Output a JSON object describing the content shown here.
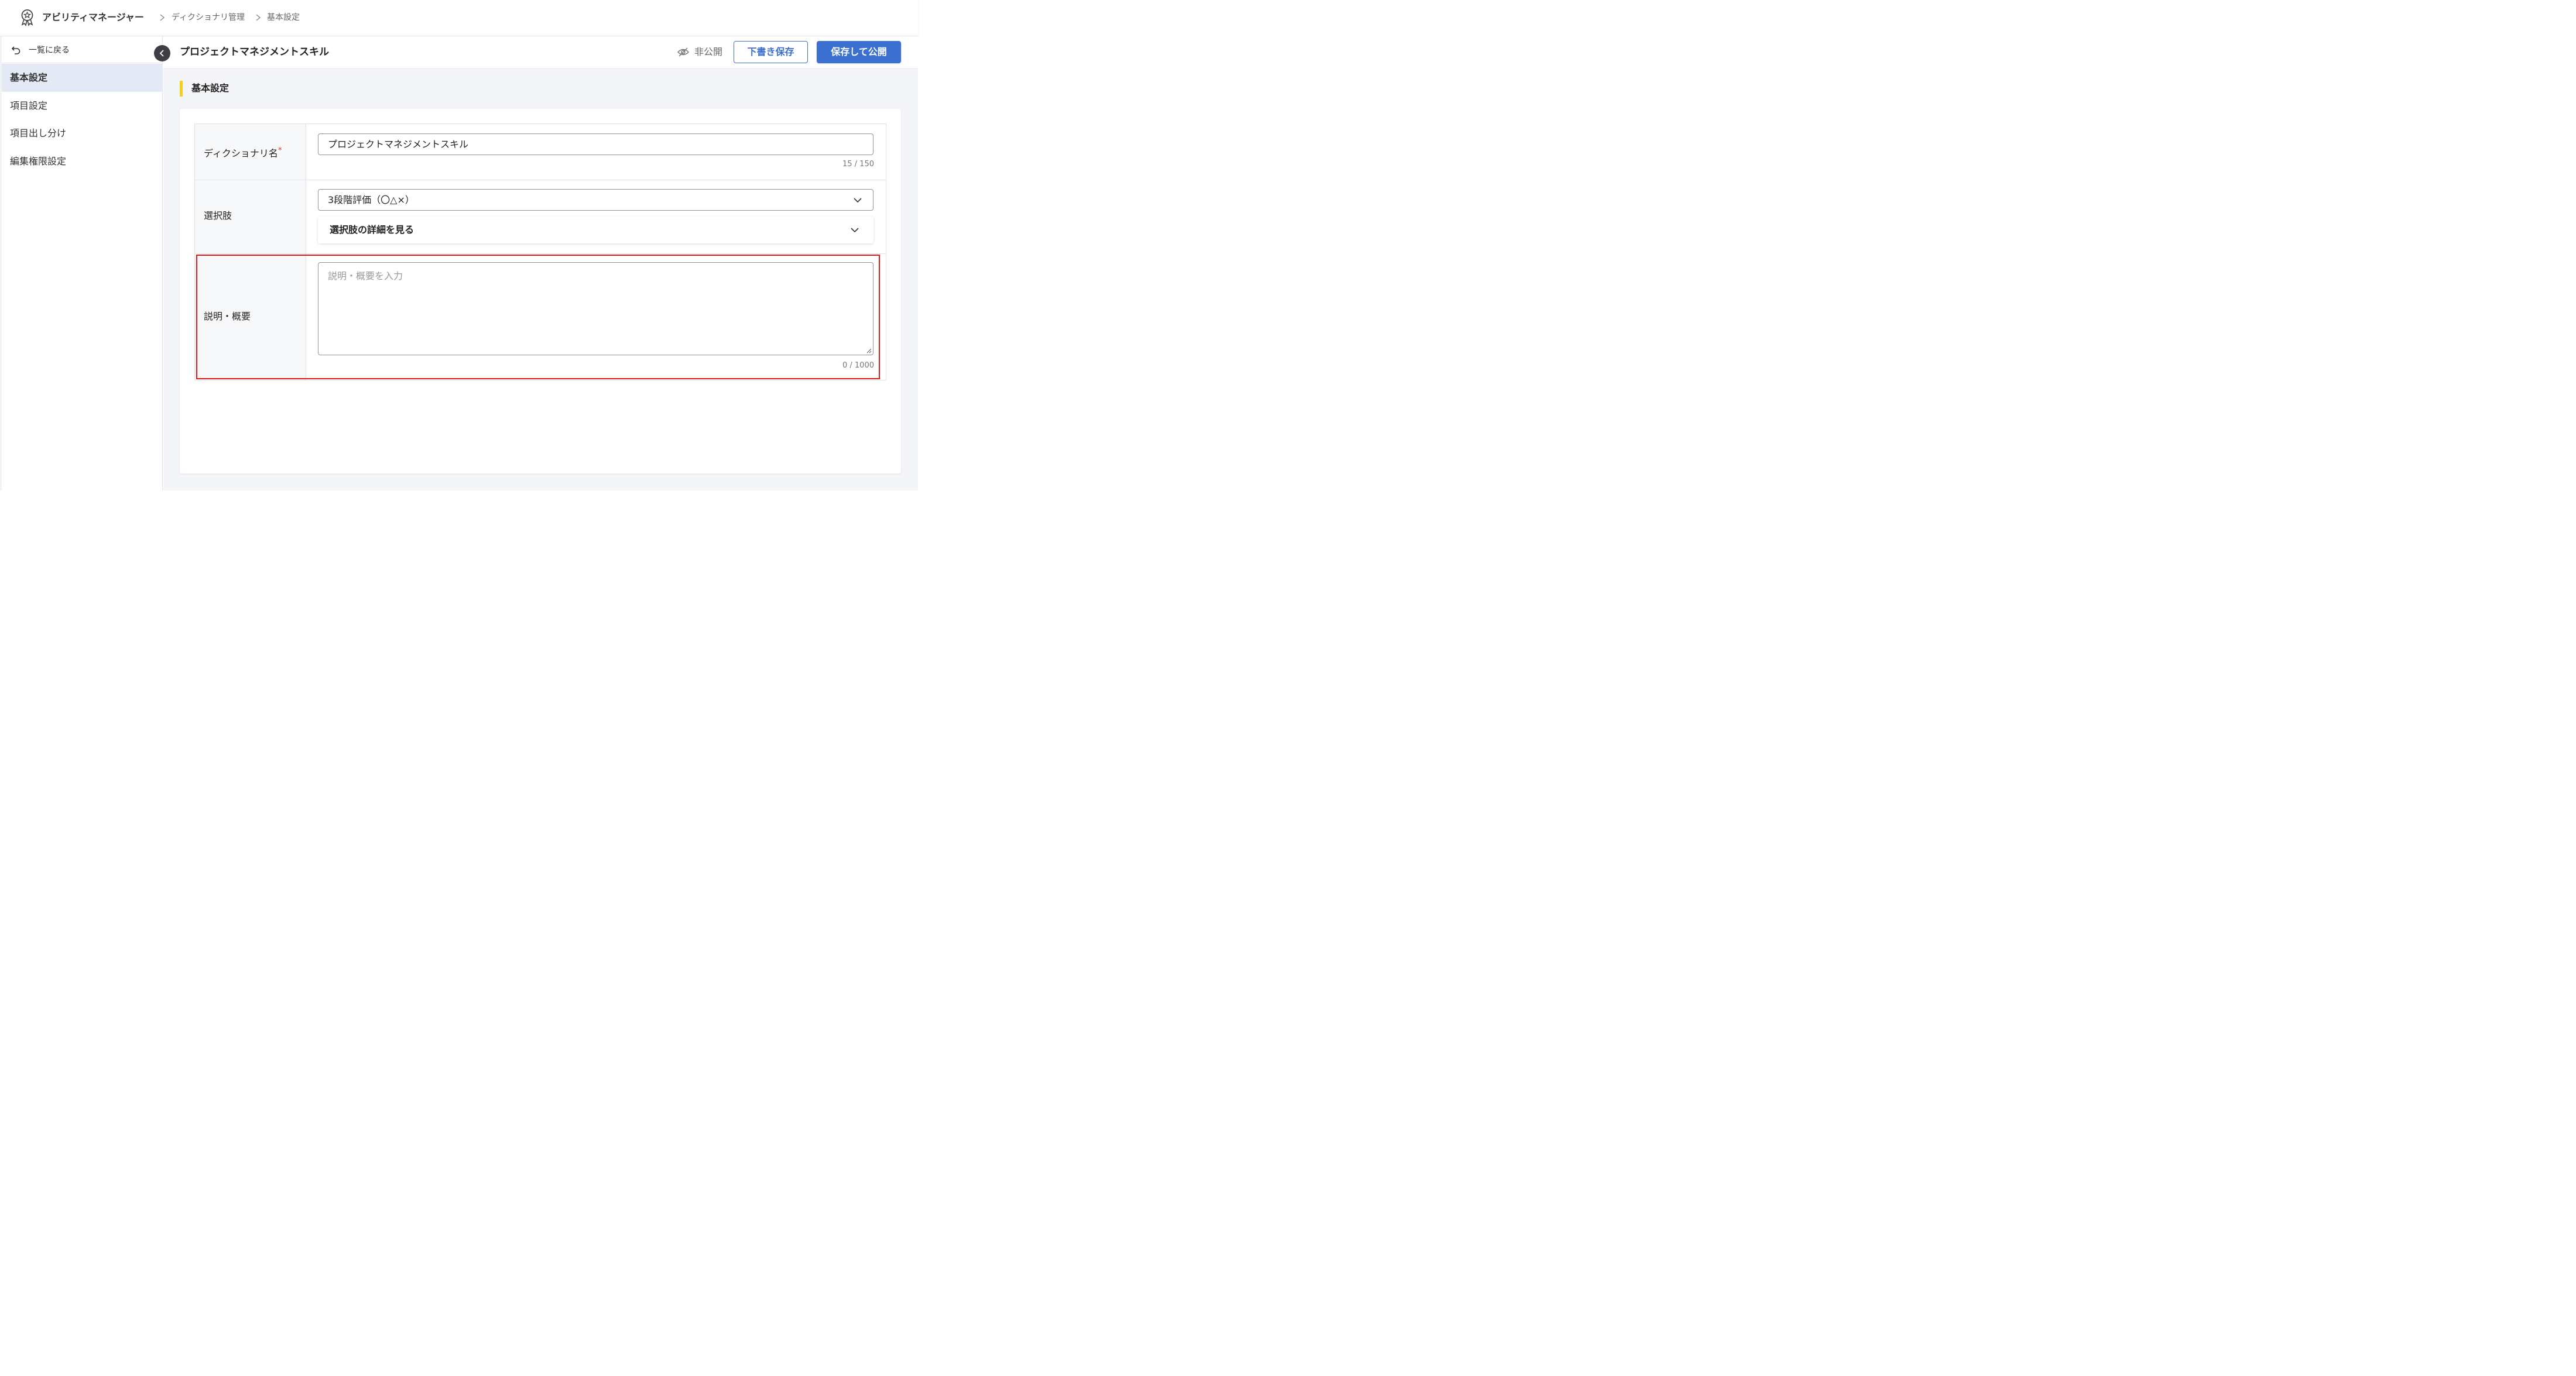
{
  "breadcrumb": {
    "app_name": "アビリティマネージャー",
    "items": [
      "ディクショナリ管理",
      "基本設定"
    ]
  },
  "sidebar": {
    "back_label": "一覧に戻る",
    "items": [
      {
        "label": "基本設定",
        "active": true
      },
      {
        "label": "項目設定",
        "active": false
      },
      {
        "label": "項目出し分け",
        "active": false
      },
      {
        "label": "編集権限設定",
        "active": false
      }
    ]
  },
  "header": {
    "title": "プロジェクトマネジメントスキル",
    "visibility_label": "非公開",
    "draft_button": "下書き保存",
    "publish_button": "保存して公開"
  },
  "section": {
    "title": "基本設定"
  },
  "form": {
    "dictionary_name": {
      "label": "ディクショナリ名",
      "required_mark": "*",
      "value": "プロジェクトマネジメントスキル",
      "counter": "15 / 150"
    },
    "options": {
      "label": "選択肢",
      "selected": "3段階評価（〇△×）",
      "details_label": "選択肢の詳細を見る"
    },
    "description": {
      "label": "説明・概要",
      "placeholder": "説明・概要を入力",
      "counter": "0 / 1000"
    }
  },
  "colors": {
    "accent": "#3b6fd0",
    "section_marker": "#f5cf1b",
    "highlight_border": "#e01b1b",
    "sidebar_active_bg": "#e3e9f5"
  },
  "icons": {
    "app": "award-badge-icon",
    "back": "undo-arrow-icon",
    "collapse": "chevron-left-icon",
    "visibility": "eye-off-icon",
    "select": "chevron-down-icon"
  }
}
